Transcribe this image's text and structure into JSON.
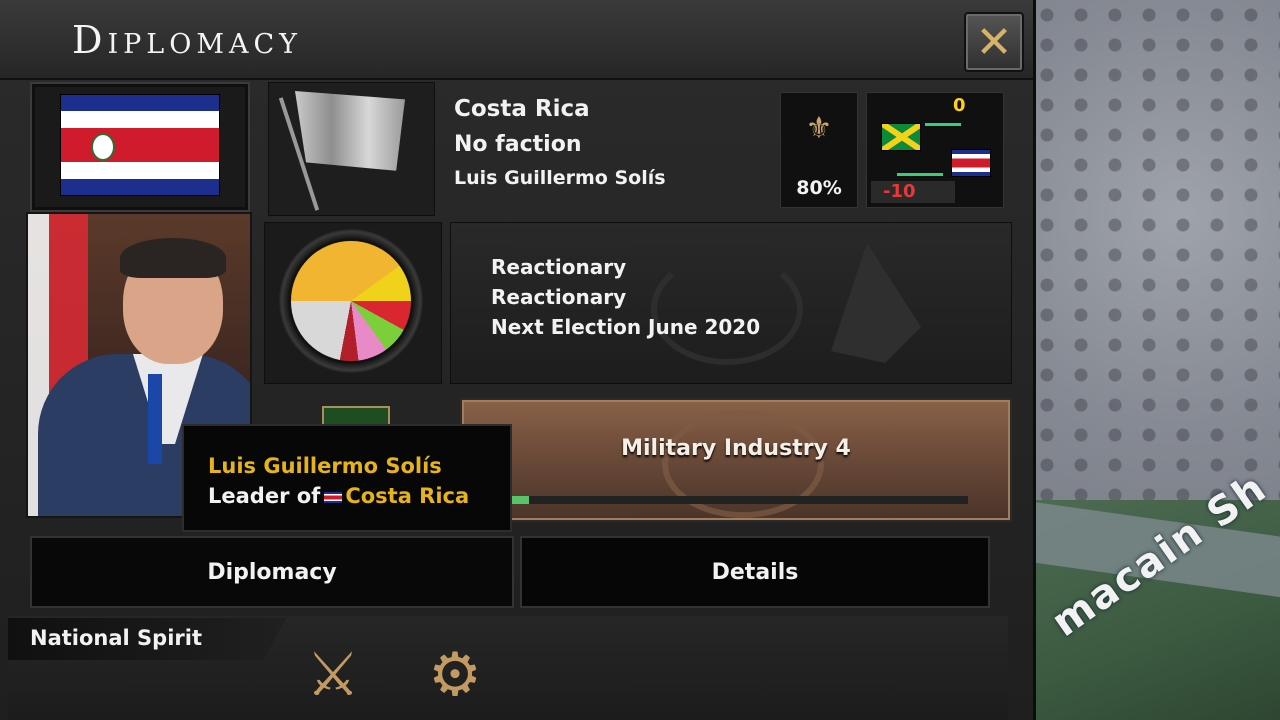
{
  "window": {
    "title": "Diplomacy",
    "close_icon": "close-icon"
  },
  "country": {
    "name": "Costa Rica",
    "faction": "No faction",
    "leader": "Luis Guillermo Solís",
    "flag_colors": [
      "#1c2f8f",
      "#ffffff",
      "#cf1b2b"
    ]
  },
  "stability": {
    "icon": "stability-icon",
    "value": "80%"
  },
  "relations": {
    "top_value": "0",
    "bottom_value": "-10",
    "accent_positive": "#ffd11a",
    "accent_negative": "#e83838"
  },
  "politics": {
    "ruling_party": "Reactionary",
    "ideology": "Reactionary",
    "next_election": "Next Election June 2020",
    "pie_slices": [
      {
        "party": "party-a",
        "color": "#f2b531",
        "share": 0.4
      },
      {
        "party": "party-b",
        "color": "#f0d21a",
        "share": 0.1
      },
      {
        "party": "party-c",
        "color": "#d9262f",
        "share": 0.08
      },
      {
        "party": "party-d",
        "color": "#7bcf3a",
        "share": 0.07
      },
      {
        "party": "party-e",
        "color": "#e88ac7",
        "share": 0.08
      },
      {
        "party": "party-f",
        "color": "#b01f2a",
        "share": 0.05
      },
      {
        "party": "party-g",
        "color": "#d8d8d8",
        "share": 0.22
      }
    ]
  },
  "research": {
    "label": "Military Industry 4",
    "progress": 0.05
  },
  "tooltip": {
    "name": "Luis Guillermo Solís",
    "leader_of_prefix": "Leader of",
    "leader_of_country": "Costa Rica"
  },
  "tabs": [
    {
      "label": "Diplomacy"
    },
    {
      "label": "Details"
    }
  ],
  "national_spirit": {
    "title": "National Spirit",
    "icons": [
      "swords-shield-icon",
      "worker-gear-icon"
    ]
  },
  "map": {
    "label": "macain Sh"
  }
}
